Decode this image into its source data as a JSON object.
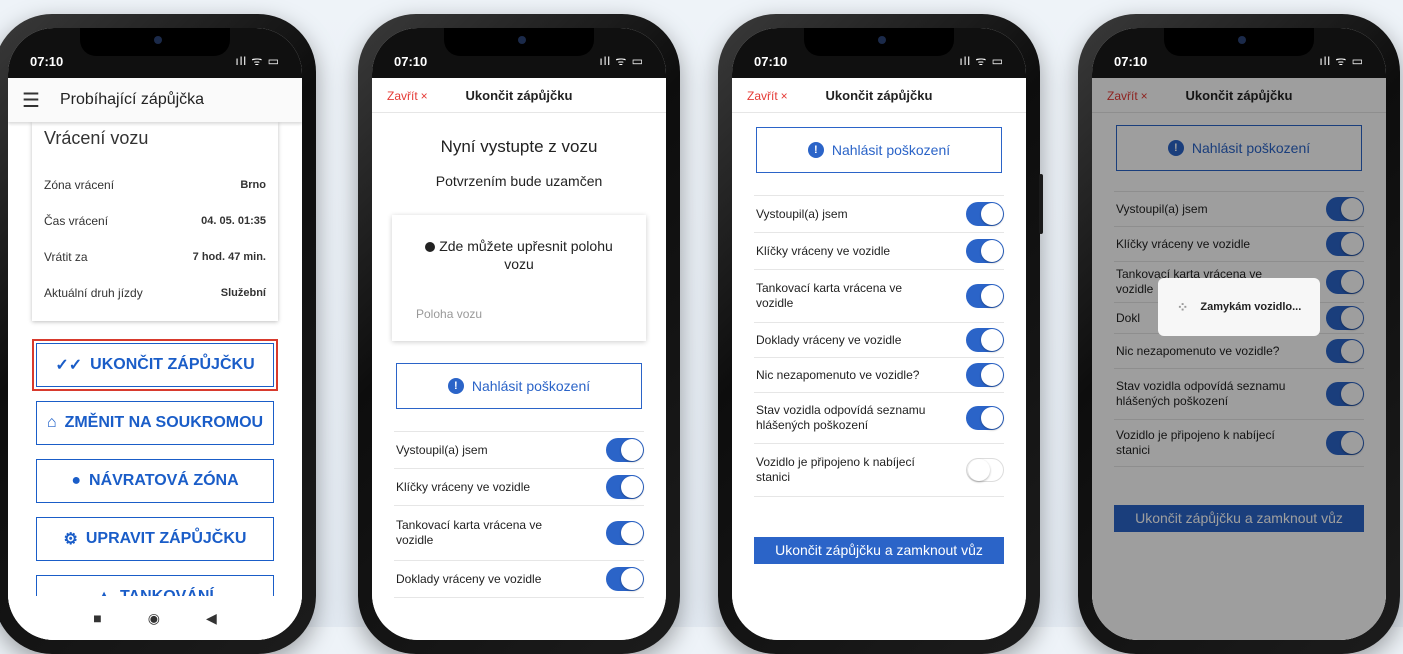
{
  "status": {
    "time": "07:10",
    "icons": "ıll ᯤ ▭"
  },
  "p1": {
    "title": "Probíhající zápůjčka",
    "card_title": "Vrácení vozu",
    "rows": [
      {
        "k": "Zóna vrácení",
        "v": "Brno"
      },
      {
        "k": "Čas vrácení",
        "v": "04. 05. 01:35"
      },
      {
        "k": "Vrátit za",
        "v": "7 hod. 47 min."
      },
      {
        "k": "Aktuální druh jízdy",
        "v": "Služební"
      }
    ],
    "buttons": [
      {
        "icon": "✓✓",
        "label": "UKONČIT ZÁPŮJČKU"
      },
      {
        "icon": "⌂",
        "label": "ZMĚNIT NA SOUKROMOU"
      },
      {
        "icon": "●",
        "label": "NÁVRATOVÁ ZÓNA"
      },
      {
        "icon": "⚙",
        "label": "UPRAVIT ZÁPŮJČKU"
      },
      {
        "icon": "▲",
        "label": "TANKOVÁNÍ"
      }
    ],
    "nav": [
      "■",
      "◉",
      "◀"
    ]
  },
  "modal": {
    "close": "Zavřít",
    "close_x": "×",
    "title": "Ukončit zápůjčku"
  },
  "p2": {
    "heading": "Nyní vystupte z vozu",
    "subheading": "Potvrzením bude uzamčen",
    "loc_text": "Zde můžete upřesnit polohu vozu",
    "loc_placeholder": "Poloha vozu"
  },
  "report": {
    "dot": "!",
    "label": "Nahlásit poškození"
  },
  "toggles": [
    {
      "label": "Vystoupil(a) jsem",
      "on": true
    },
    {
      "label": "Klíčky vráceny ve vozidle",
      "on": true
    },
    {
      "label": "Tankovací karta vrácena ve vozidle",
      "on": true
    },
    {
      "label": "Doklady vráceny ve vozidle",
      "on": true
    },
    {
      "label": "Nic nezapomenuto ve vozidle?",
      "on": true
    },
    {
      "label": "Stav vozidla odpovídá seznamu hlášených poškození",
      "on": true
    },
    {
      "label": "Vozidlo je připojeno k nabíjecí stanici",
      "on": false
    }
  ],
  "toggles4": [
    {
      "label": "Vystoupil(a) jsem"
    },
    {
      "label": "Klíčky vráceny ve vozidle"
    },
    {
      "label": "Tankovací karta vrácena ve vozidle"
    },
    {
      "label": "Dokl"
    },
    {
      "label": "Nic nezapomenuto ve vozidle?"
    },
    {
      "label": "Stav vozidla odpovídá seznamu hlášených poškození"
    },
    {
      "label": "Vozidlo je připojeno k nabíjecí stanici"
    }
  ],
  "submit": "Ukončit zápůjčku a zamknout vůz",
  "spinner": "Zamykám vozidlo..."
}
